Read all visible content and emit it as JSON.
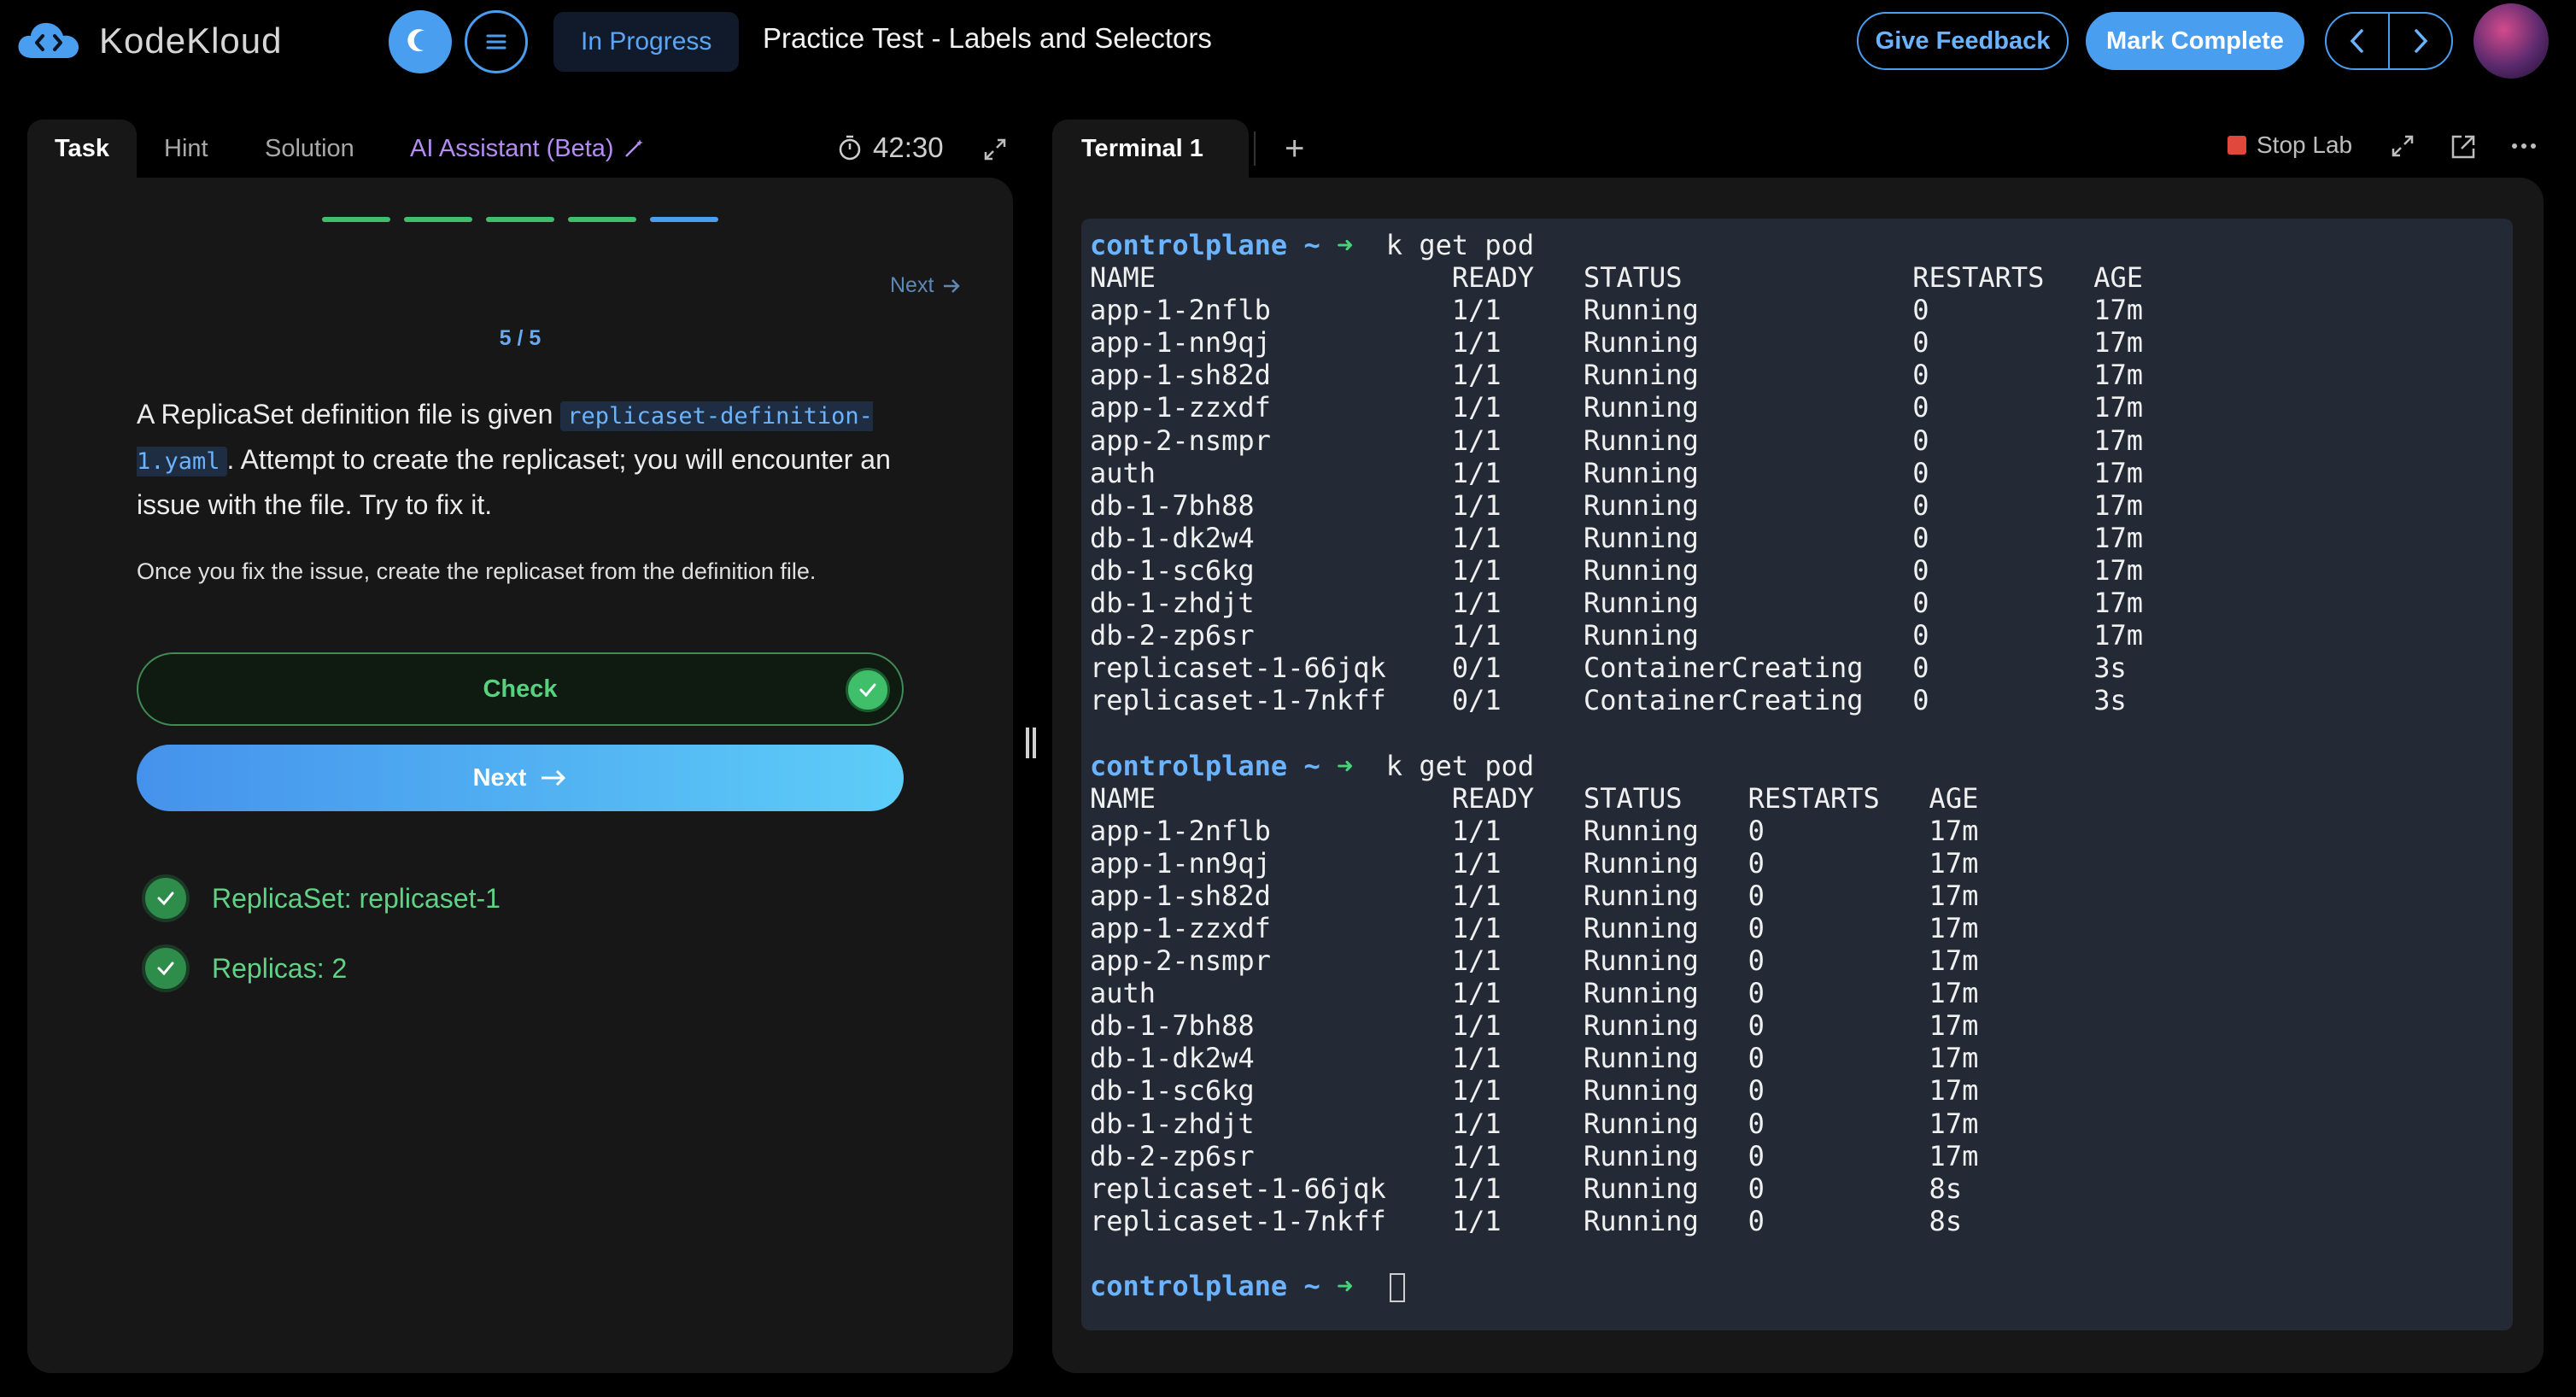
{
  "app": {
    "brand": "KodeKloud",
    "status": "In Progress",
    "title": "Practice Test - Labels and Selectors",
    "feedback_label": "Give Feedback",
    "complete_label": "Mark Complete",
    "accent": "#4a9ef0"
  },
  "left": {
    "tabs": {
      "task": "Task",
      "hint": "Hint",
      "solution": "Solution",
      "ai": "AI Assistant (Beta)"
    },
    "timer": "42:30",
    "next_link": "Next",
    "progress": {
      "current": 5,
      "total": 5
    },
    "page_count": "5 / 5",
    "task": {
      "p1_before": "A ReplicaSet definition file is given ",
      "p1_code": "replicaset-definition-1.yaml",
      "p1_after": ". Attempt to create the replicaset; you will encounter an issue with the file. Try to fix it.",
      "p2": "Once you fix the issue, create the replicaset from the definition file."
    },
    "check_label": "Check",
    "next_label": "Next",
    "results": [
      {
        "label": "ReplicaSet: replicaset-1",
        "status": "passed"
      },
      {
        "label": "Replicas: 2",
        "status": "passed"
      }
    ]
  },
  "right": {
    "tab_label": "Terminal 1",
    "stop_label": "Stop Lab",
    "terminal": {
      "lines": [
        {
          "type": "prompt",
          "host": "controlplane",
          "path": "~",
          "cmd": "k get pod"
        },
        {
          "type": "out",
          "text": "NAME                  READY   STATUS              RESTARTS   AGE"
        },
        {
          "type": "out",
          "text": "app-1-2nflb           1/1     Running             0          17m"
        },
        {
          "type": "out",
          "text": "app-1-nn9qj           1/1     Running             0          17m"
        },
        {
          "type": "out",
          "text": "app-1-sh82d           1/1     Running             0          17m"
        },
        {
          "type": "out",
          "text": "app-1-zzxdf           1/1     Running             0          17m"
        },
        {
          "type": "out",
          "text": "app-2-nsmpr           1/1     Running             0          17m"
        },
        {
          "type": "out",
          "text": "auth                  1/1     Running             0          17m"
        },
        {
          "type": "out",
          "text": "db-1-7bh88            1/1     Running             0          17m"
        },
        {
          "type": "out",
          "text": "db-1-dk2w4            1/1     Running             0          17m"
        },
        {
          "type": "out",
          "text": "db-1-sc6kg            1/1     Running             0          17m"
        },
        {
          "type": "out",
          "text": "db-1-zhdjt            1/1     Running             0          17m"
        },
        {
          "type": "out",
          "text": "db-2-zp6sr            1/1     Running             0          17m"
        },
        {
          "type": "out",
          "text": "replicaset-1-66jqk    0/1     ContainerCreating   0          3s"
        },
        {
          "type": "out",
          "text": "replicaset-1-7nkff    0/1     ContainerCreating   0          3s"
        },
        {
          "type": "blank",
          "text": ""
        },
        {
          "type": "prompt",
          "host": "controlplane",
          "path": "~",
          "cmd": "k get pod"
        },
        {
          "type": "out",
          "text": "NAME                  READY   STATUS    RESTARTS   AGE"
        },
        {
          "type": "out",
          "text": "app-1-2nflb           1/1     Running   0          17m"
        },
        {
          "type": "out",
          "text": "app-1-nn9qj           1/1     Running   0          17m"
        },
        {
          "type": "out",
          "text": "app-1-sh82d           1/1     Running   0          17m"
        },
        {
          "type": "out",
          "text": "app-1-zzxdf           1/1     Running   0          17m"
        },
        {
          "type": "out",
          "text": "app-2-nsmpr           1/1     Running   0          17m"
        },
        {
          "type": "out",
          "text": "auth                  1/1     Running   0          17m"
        },
        {
          "type": "out",
          "text": "db-1-7bh88            1/1     Running   0          17m"
        },
        {
          "type": "out",
          "text": "db-1-dk2w4            1/1     Running   0          17m"
        },
        {
          "type": "out",
          "text": "db-1-sc6kg            1/1     Running   0          17m"
        },
        {
          "type": "out",
          "text": "db-1-zhdjt            1/1     Running   0          17m"
        },
        {
          "type": "out",
          "text": "db-2-zp6sr            1/1     Running   0          17m"
        },
        {
          "type": "out",
          "text": "replicaset-1-66jqk    1/1     Running   0          8s"
        },
        {
          "type": "out",
          "text": "replicaset-1-7nkff    1/1     Running   0          8s"
        },
        {
          "type": "blank",
          "text": ""
        },
        {
          "type": "prompt",
          "host": "controlplane",
          "path": "~",
          "cmd": ""
        }
      ]
    }
  }
}
